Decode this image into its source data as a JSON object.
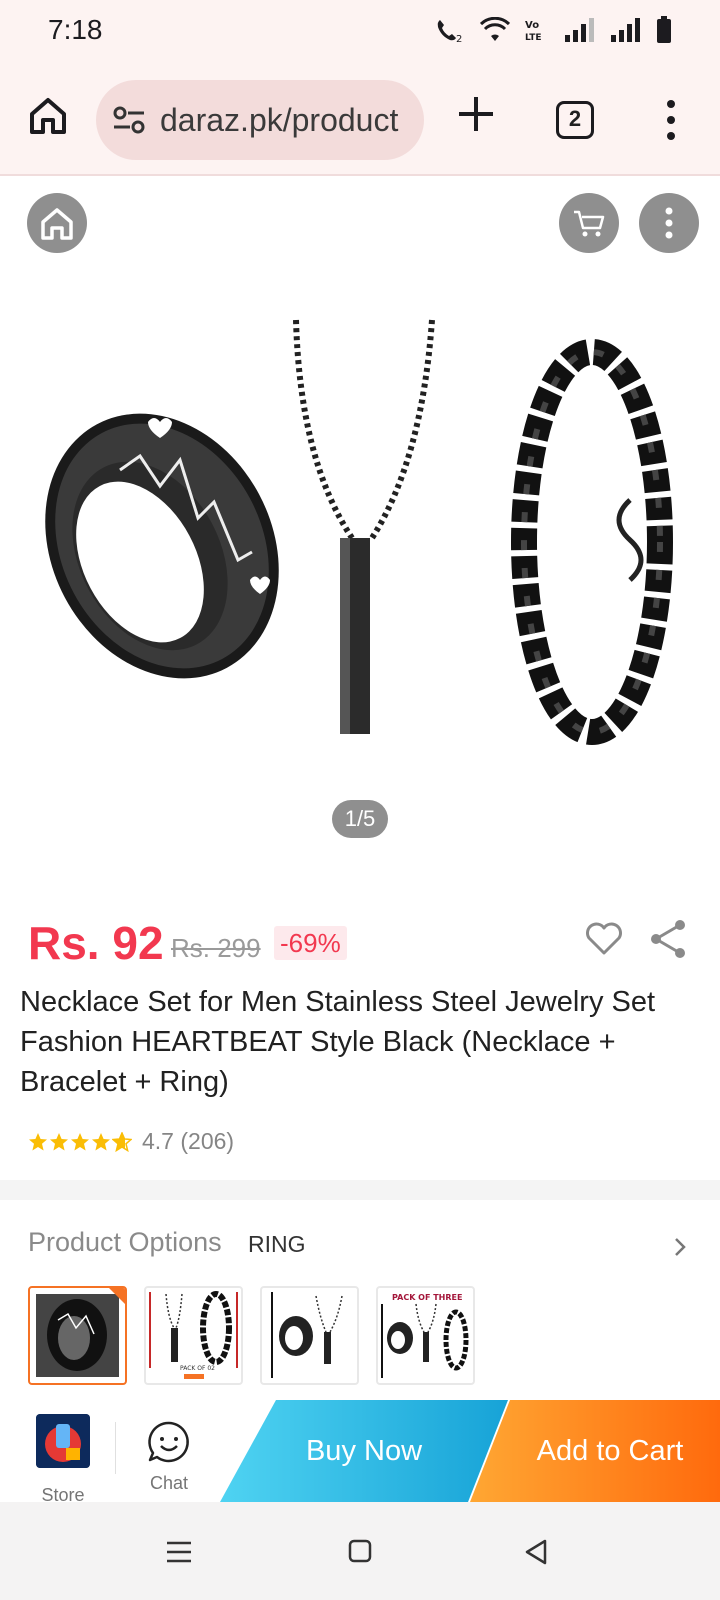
{
  "status_bar": {
    "time": "7:18"
  },
  "browser": {
    "url": "daraz.pk/product",
    "tab_count": "2"
  },
  "gallery": {
    "counter": "1/5"
  },
  "product": {
    "price": "Rs. 92",
    "original_price": "Rs. 299",
    "discount": "-69%",
    "title": "Necklace Set for Men Stainless Steel Jewelry Set Fashion HEARTBEAT Style Black (Necklace + Bracelet + Ring)",
    "rating": 4.7,
    "rating_text": "4.7 (206)"
  },
  "options": {
    "label": "Product Options",
    "selected": "RING",
    "thumb_badges": [
      "PACK OF 02",
      "PACK OF THREE"
    ]
  },
  "actions": {
    "store_label": "Store",
    "chat_label": "Chat",
    "buy_now": "Buy Now",
    "add_to_cart": "Add to Cart"
  },
  "colors": {
    "price": "#f2384f",
    "buy_now": "#17a3d7",
    "add_to_cart": "#ff6a0d",
    "selected_border": "#f57224"
  }
}
